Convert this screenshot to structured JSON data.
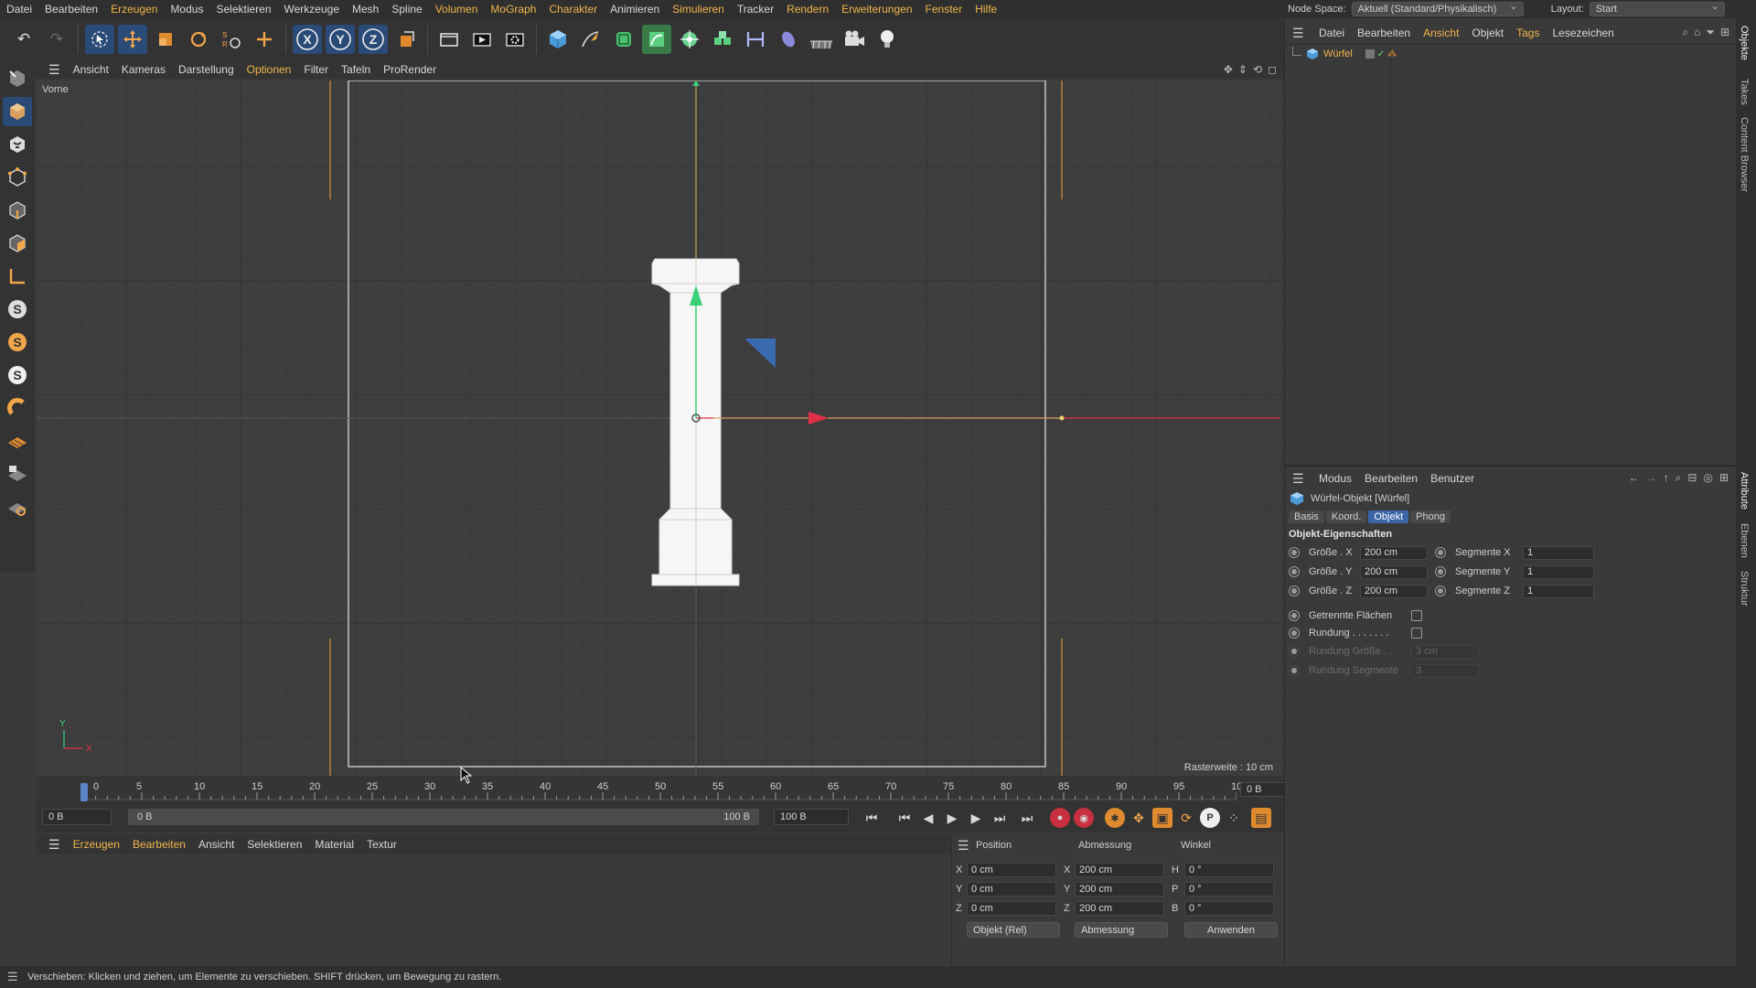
{
  "menubar": {
    "items": [
      "Datei",
      "Bearbeiten",
      "Erzeugen",
      "Modus",
      "Selektieren",
      "Werkzeuge",
      "Mesh",
      "Spline",
      "Volumen",
      "MoGraph",
      "Charakter",
      "Animieren",
      "Simulieren",
      "Tracker",
      "Rendern",
      "Erweiterungen",
      "Fenster",
      "Hilfe"
    ],
    "node_space_label": "Node Space:",
    "node_space_value": "Aktuell (Standard/Physikalisch)",
    "layout_label": "Layout:",
    "layout_value": "Start"
  },
  "toolbar": {
    "icons": [
      "undo-icon",
      "redo-icon",
      "select-icon",
      "move-icon",
      "scale-icon",
      "rotate-icon",
      "recent-tools-icon",
      "add-icon",
      "x-axis-icon",
      "y-axis-icon",
      "z-axis-icon",
      "coordinate-system-icon",
      "render-region-icon",
      "render-view-icon",
      "render-settings-icon",
      "cube-icon",
      "pen-icon",
      "subdivision-icon",
      "spline-icon",
      "mograph-icon",
      "array-icon",
      "deformer-icon",
      "field-icon",
      "floor-icon",
      "camera-icon",
      "light-icon"
    ],
    "axis_labels": [
      "X",
      "Y",
      "Z"
    ]
  },
  "left_tools": {
    "icons": [
      "make-editable-icon",
      "model-mode-icon",
      "texture-mode-icon",
      "points-mode-icon",
      "edges-mode-icon",
      "polygons-mode-icon",
      "axis-mode-icon",
      "solo-off-icon",
      "solo-single-icon",
      "solo-hierarchy-icon",
      "snap-icon",
      "workplane-icon",
      "locked-workplane-icon",
      "grid-snap-icon"
    ],
    "solo_letter": "S"
  },
  "viewport": {
    "menu": [
      "Ansicht",
      "Kameras",
      "Darstellung",
      "Optionen",
      "Filter",
      "Tafeln",
      "ProRender"
    ],
    "view_name": "Vorne",
    "grid_info": "Rasterweite : 10 cm",
    "axis_y": "Y",
    "axis_x": "X"
  },
  "timeline": {
    "ticks": [
      "0",
      "5",
      "10",
      "15",
      "20",
      "25",
      "30",
      "35",
      "40",
      "45",
      "50",
      "55",
      "60",
      "65",
      "70",
      "75",
      "80",
      "85",
      "90",
      "95",
      "100"
    ],
    "current_frame": "0 B",
    "start_field": "0 B",
    "range_start": "0 B",
    "range_end": "100 B",
    "end_field": "100 B",
    "current_frame_position": 0
  },
  "material_manager": {
    "menu": [
      "Erzeugen",
      "Bearbeiten",
      "Ansicht",
      "Selektieren",
      "Material",
      "Textur"
    ]
  },
  "coord_manager": {
    "headers": [
      "Position",
      "Abmessung",
      "Winkel"
    ],
    "rows": [
      {
        "axis": "X",
        "pos": "0 cm",
        "dim_axis": "X",
        "dim": "200 cm",
        "rot_axis": "H",
        "rot": "0 °"
      },
      {
        "axis": "Y",
        "pos": "0 cm",
        "dim_axis": "Y",
        "dim": "200 cm",
        "rot_axis": "P",
        "rot": "0 °"
      },
      {
        "axis": "Z",
        "pos": "0 cm",
        "dim_axis": "Z",
        "dim": "200 cm",
        "rot_axis": "B",
        "rot": "0 °"
      }
    ],
    "mode_select": "Objekt (Rel)",
    "dim_select": "Abmessung",
    "apply_button": "Anwenden"
  },
  "object_manager": {
    "menu": [
      "Datei",
      "Bearbeiten",
      "Ansicht",
      "Objekt",
      "Tags",
      "Lesezeichen"
    ],
    "objects": [
      {
        "name": "Würfel",
        "icon": "cube-icon"
      }
    ]
  },
  "attribute_manager": {
    "menu": [
      "Modus",
      "Bearbeiten",
      "Benutzer"
    ],
    "object_title": "Würfel-Objekt [Würfel]",
    "tabs": [
      "Basis",
      "Koord.",
      "Objekt",
      "Phong"
    ],
    "active_tab": "Objekt",
    "section_title": "Objekt-Eigenschaften",
    "size_rows": [
      {
        "label": "Größe . X",
        "value": "200 cm",
        "seg_label": "Segmente X",
        "seg_value": "1"
      },
      {
        "label": "Größe . Y",
        "value": "200 cm",
        "seg_label": "Segmente Y",
        "seg_value": "1"
      },
      {
        "label": "Größe . Z",
        "value": "200 cm",
        "seg_label": "Segmente Z",
        "seg_value": "1"
      }
    ],
    "separate_faces": "Getrennte Flächen",
    "fillet": "Rundung . . . . . . .",
    "fillet_size_label": "Rundung Größe . .",
    "fillet_size_value": "3 cm",
    "fillet_segments_label": "Rundung Segmente",
    "fillet_segments_value": "3"
  },
  "side_tabs_top": [
    "Objekte",
    "Takes",
    "Content Browser"
  ],
  "side_tabs_bottom": [
    "Attribute",
    "Ebenen",
    "Struktur"
  ],
  "status": "Verschieben: Klicken und ziehen, um Elemente zu verschieben. SHIFT drücken, um Bewegung zu rastern.",
  "colors": {
    "accent": "#f0b54a",
    "selection_blue": "#3a66a8",
    "x_axis": "#e0304a",
    "y_axis": "#3ad07a",
    "guide_orange": "#e8a030"
  }
}
